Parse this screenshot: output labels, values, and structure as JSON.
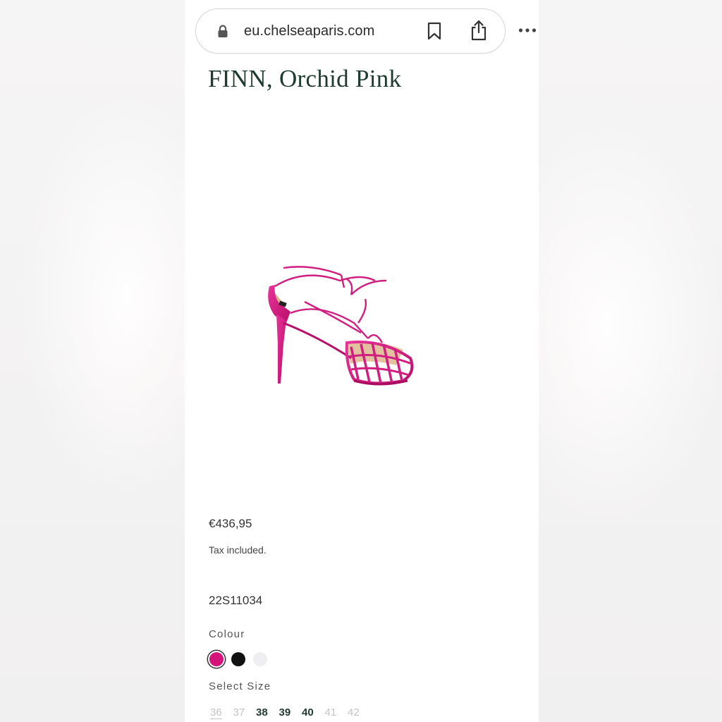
{
  "browser": {
    "url": "eu.chelseaparis.com"
  },
  "product": {
    "title": "FINN, Orchid Pink",
    "image_alt_icon": "shoe-product-image",
    "price": "€436,95",
    "tax_note": "Tax included.",
    "sku": "22S11034"
  },
  "colour": {
    "label": "Colour",
    "swatches": [
      {
        "name": "orchid-pink",
        "color": "#d4147a",
        "selected": true
      },
      {
        "name": "black",
        "color": "#111111",
        "selected": false
      },
      {
        "name": "white",
        "color": "#eeeef3",
        "selected": false
      }
    ]
  },
  "size": {
    "label": "Select Size",
    "options": [
      {
        "value": "36",
        "state": "selected"
      },
      {
        "value": "37",
        "state": "unavailable"
      },
      {
        "value": "38",
        "state": "available"
      },
      {
        "value": "39",
        "state": "available"
      },
      {
        "value": "40",
        "state": "available"
      },
      {
        "value": "41",
        "state": "unavailable"
      },
      {
        "value": "42",
        "state": "unavailable"
      }
    ]
  },
  "colors": {
    "brand_green": "#1f3a2e",
    "product_pink": "#d4147a"
  }
}
